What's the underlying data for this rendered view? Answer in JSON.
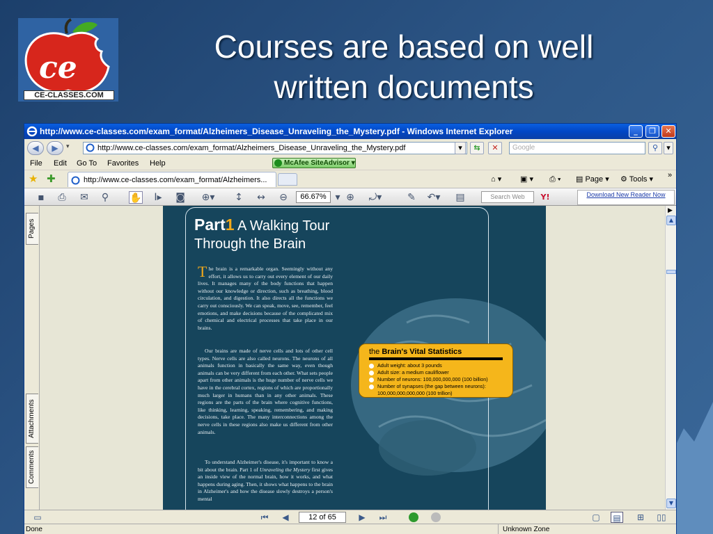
{
  "slide": {
    "title_line1": "Courses are based on well",
    "title_line2": "written documents",
    "logo_text": "CE-CLASSES.COM"
  },
  "browser": {
    "window_title": "http://www.ce-classes.com/exam_format/Alzheimers_Disease_Unraveling_the_Mystery.pdf - Windows Internet Explorer",
    "address": "http://www.ce-classes.com/exam_format/Alzheimers_Disease_Unraveling_the_Mystery.pdf",
    "search_placeholder": "Google",
    "menu": [
      "File",
      "Edit",
      "Go To",
      "Favorites",
      "Help"
    ],
    "mcafee_label": "McAfee SiteAdvisor",
    "tab_title": "http://www.ce-classes.com/exam_format/Alzheimers...",
    "page_label": "Page",
    "tools_label": "Tools",
    "status_left": "Done",
    "status_zone": "Unknown Zone"
  },
  "acrobat": {
    "zoom": "66.67%",
    "search_web_placeholder": "Search Web",
    "download_label": "Download New Reader Now",
    "side_tabs": [
      "Pages",
      "Attachments",
      "Comments"
    ],
    "page_indicator": "12 of 65"
  },
  "document": {
    "part": "Part",
    "part_number": "1",
    "heading_rest": "A Walking Tour",
    "heading_line2": "Through the Brain",
    "drop_cap": "T",
    "para1": "he brain is a remarkable organ.  Seemingly without any effort, it allows us to carry out every element of our daily lives.  It manages many of the body functions that happen without our knowledge or direction, such as breathing, blood circulation, and digestion.  It also directs all the functions we carry out consciously.  We can speak, move, see, remember, feel emotions, and make decisions because of the complicated mix of chemical and electrical processes that take place in our brains.",
    "para2": "Our brains are made of nerve cells and lots of other cell types.  Nerve cells are also called neurons.  The neurons of all animals function in basically the same way, even though animals can be very different from each other.  What sets people apart from other animals is the huge number of nerve cells we have in the cerebral cortex, regions of which are proportionally much larger in humans than in any other animals.  These regions are the parts of the brain where cognitive functions, like thinking, learning, speaking, remembering, and making decisions, take place.  The many interconnections among the nerve cells in these regions also make us different from other animals.",
    "para3_a": "To understand Alzheimer's disease, it's important to know a bit about the brain.  Part 1 of",
    "para3_italic": "Unraveling the Mystery",
    "para3_b": "first gives an inside view of the normal brain, how it works, and what happens during aging.  Then, it shows what happens to the brain in Alzheimer's and how the disease slowly destroys a person's mental",
    "stats_the": "the",
    "stats_title": "Brain's Vital Statistics",
    "stats": [
      "Adult weight:  about 3 pounds",
      "Adult size:  a medium cauliflower",
      "Number of neurons:  100,000,000,000 (100 billion)",
      "Number of synapses (the gap between neurons):"
    ],
    "stats_cont": "100,000,000,000,000 (100 trillion)"
  }
}
